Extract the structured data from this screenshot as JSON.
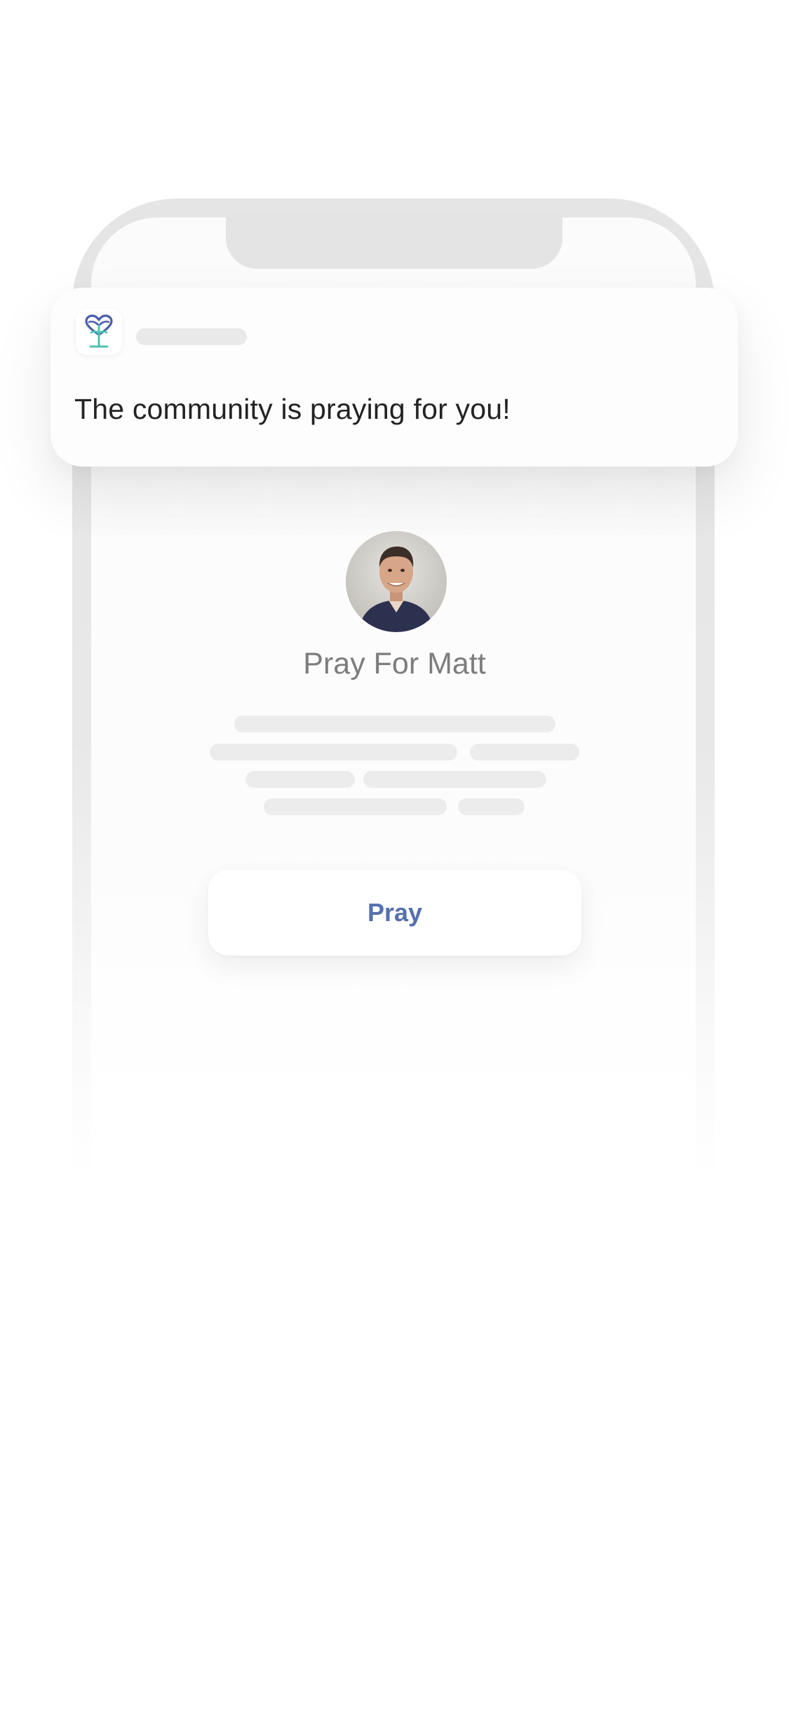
{
  "notification": {
    "message": "The community is praying for you!",
    "app_icon": "heart-plant-logo-icon"
  },
  "prayer": {
    "title": "Pray For Matt",
    "avatar": "avatar-photo"
  },
  "actions": {
    "pray_label": "Pray"
  },
  "colors": {
    "accent": "#5670ac",
    "logo_blue": "#4a5fa8",
    "logo_teal": "#4cc3b0",
    "skeleton": "#ececec"
  }
}
